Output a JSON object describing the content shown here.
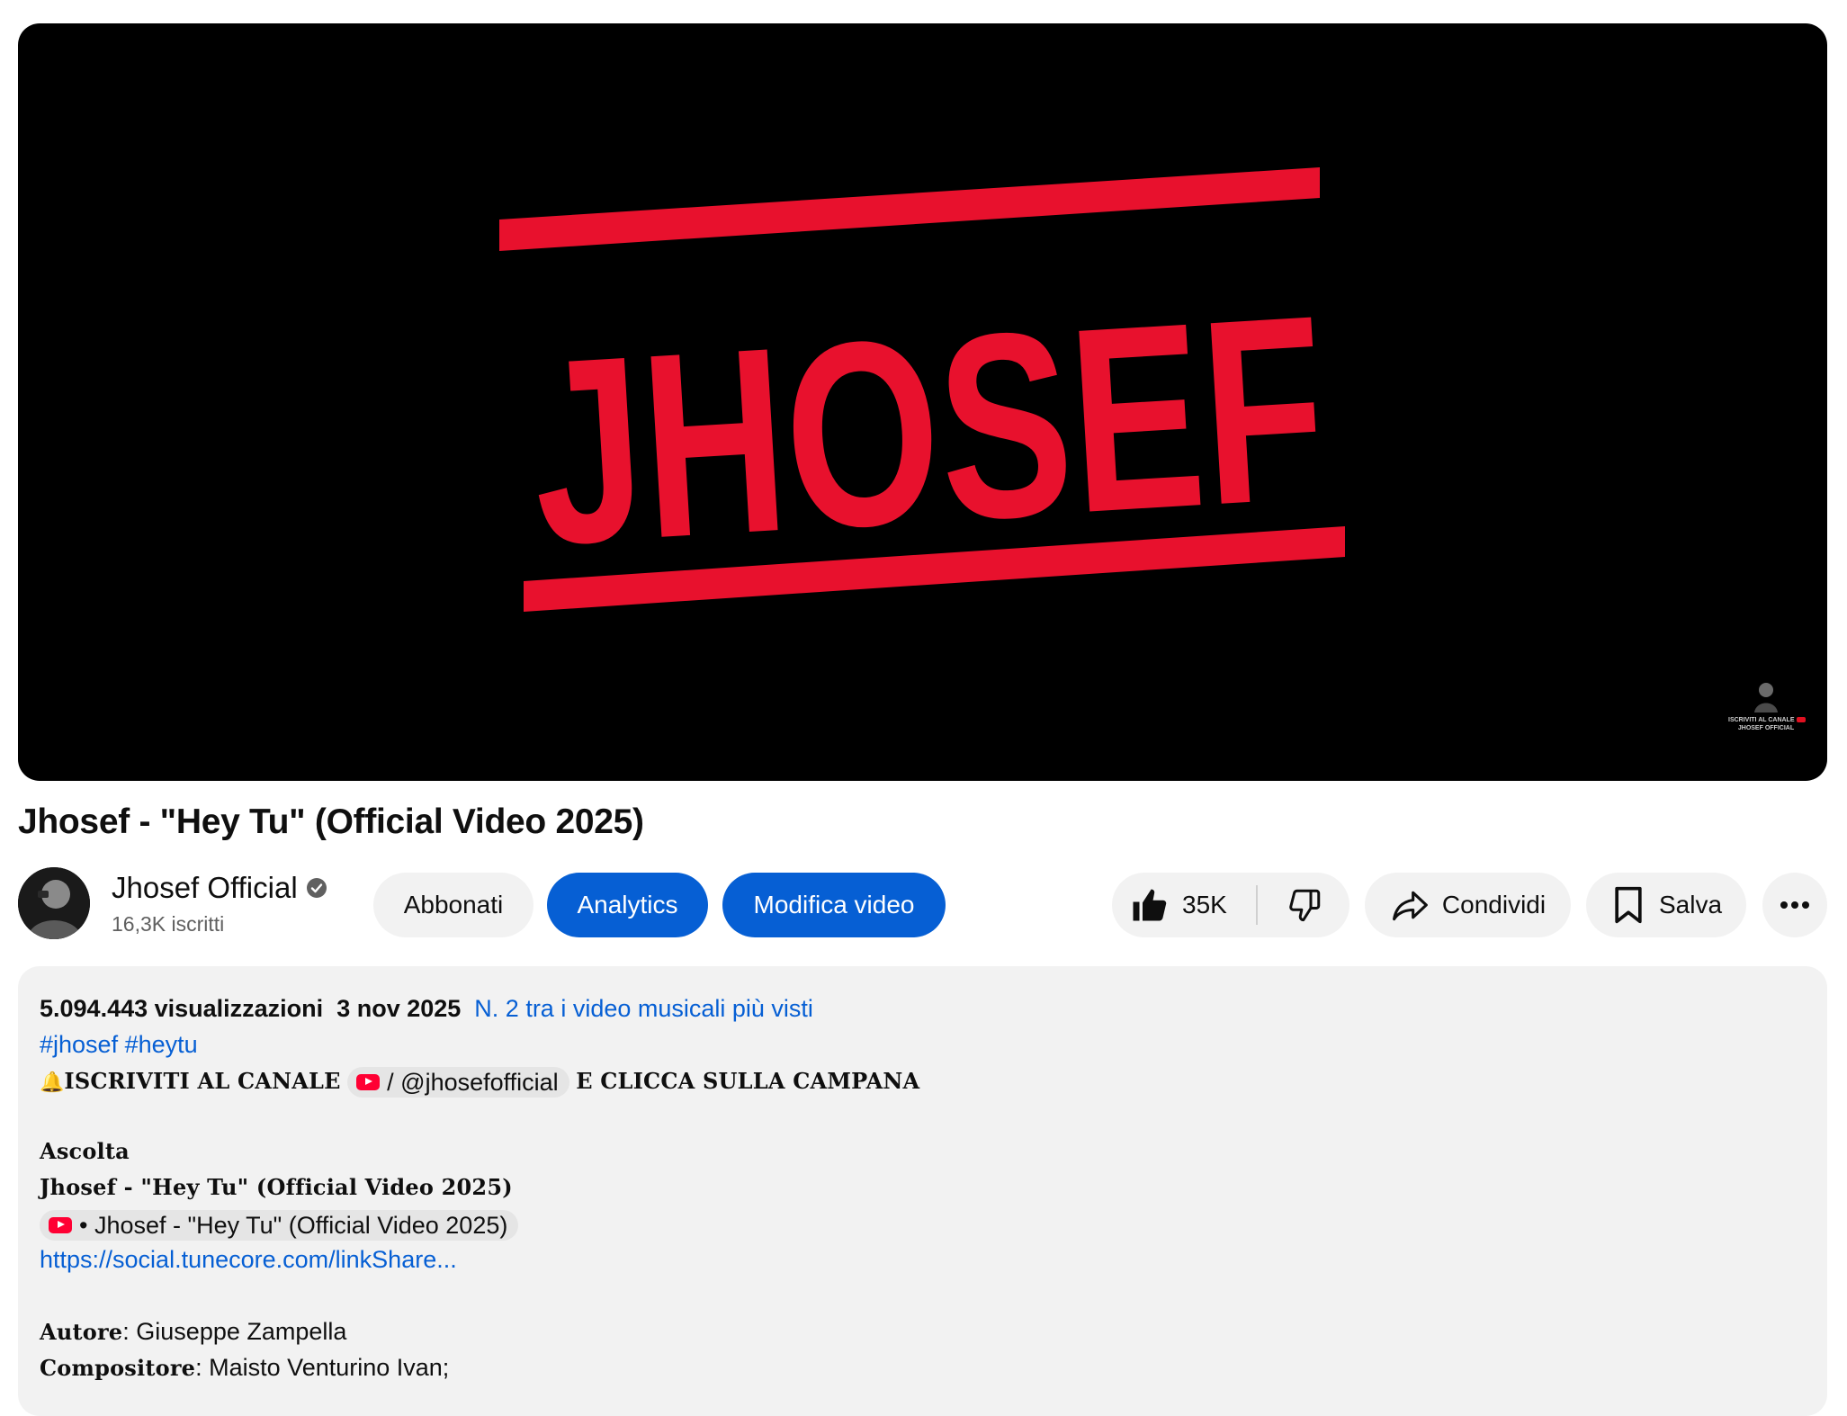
{
  "video": {
    "logo_text": "JHOSEF",
    "watermark": {
      "line1": "ISCRIVITI AL CANALE",
      "line2": "JHOSEF OFFICIAL"
    }
  },
  "title": "Jhosef - \"Hey Tu\" (Official Video 2025)",
  "channel": {
    "name": "Jhosef Official",
    "subscribers": "16,3K iscritti",
    "verified_icon": "verified-badge-icon"
  },
  "actions": {
    "subscribe": "Abbonati",
    "analytics": "Analytics",
    "edit": "Modifica video",
    "likes": "35K",
    "share": "Condividi",
    "save": "Salva"
  },
  "colors": {
    "accent_blue": "#065fd4",
    "pill_bg": "#f2f2f2",
    "logo_red": "#e8112d",
    "yt_red": "#ff0033"
  },
  "description": {
    "views": "5.094.443 visualizzazioni",
    "date": "3 nov 2025",
    "rank": "N. 2 tra i video musicali più visti",
    "hashtag1": "#jhosef",
    "hashtag2": "#heytu",
    "bell_emoji": "🔔",
    "subscribe_text": "ISCRIVITI AL CANALE",
    "channel_handle": "/ @jhosefofficial",
    "bell_text": "E CLICCA SULLA CAMPANA",
    "listen_heading": "Ascolta",
    "listen_title": "Jhosef - \"Hey Tu\" (Official Video 2025)",
    "video_chip": "• Jhosef - \"Hey Tu\" (Official Video 2025)",
    "link": "https://social.tunecore.com/linkShare...",
    "author_label": "Autore",
    "author_value": ": Giuseppe Zampella",
    "composer_label": "Compositore",
    "composer_value": ": Maisto Venturino Ivan;"
  }
}
